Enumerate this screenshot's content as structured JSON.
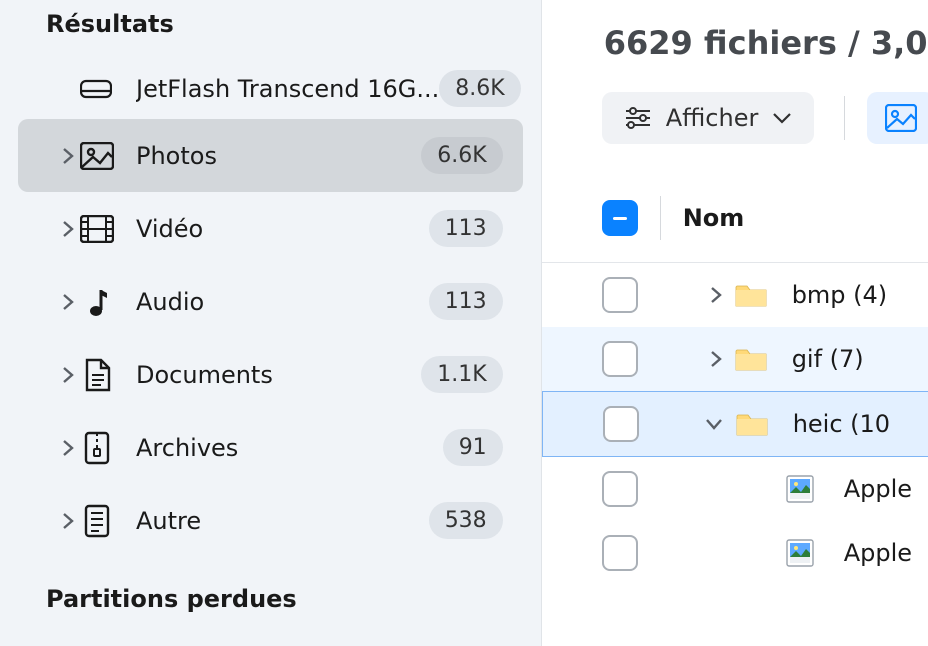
{
  "sidebar": {
    "title": "Résultats",
    "device": {
      "label": "JetFlash Transcend 16G...",
      "count": "8.6K"
    },
    "categories": [
      {
        "id": "photos",
        "label": "Photos",
        "count": "6.6K",
        "icon": "image",
        "active": true
      },
      {
        "id": "video",
        "label": "Vidéo",
        "count": "113",
        "icon": "film"
      },
      {
        "id": "audio",
        "label": "Audio",
        "count": "113",
        "icon": "note"
      },
      {
        "id": "documents",
        "label": "Documents",
        "count": "1.1K",
        "icon": "doc"
      },
      {
        "id": "archives",
        "label": "Archives",
        "count": "91",
        "icon": "zip"
      },
      {
        "id": "other",
        "label": "Autre",
        "count": "538",
        "icon": "other"
      }
    ],
    "subtitle": "Partitions perdues"
  },
  "main": {
    "summary": "6629 fichiers / 3,0",
    "toolbar": {
      "display_label": "Afficher"
    },
    "table": {
      "col_name": "Nom"
    },
    "rows": [
      {
        "type": "folder",
        "label": "bmp (4)",
        "expand": "right"
      },
      {
        "type": "folder",
        "label": "gif (7)",
        "expand": "right",
        "sel": 1
      },
      {
        "type": "folder",
        "label": "heic (10",
        "expand": "down",
        "sel": 2
      },
      {
        "type": "file",
        "label": "Apple",
        "indent": 1
      },
      {
        "type": "file",
        "label": "Apple",
        "indent": 1
      }
    ]
  }
}
